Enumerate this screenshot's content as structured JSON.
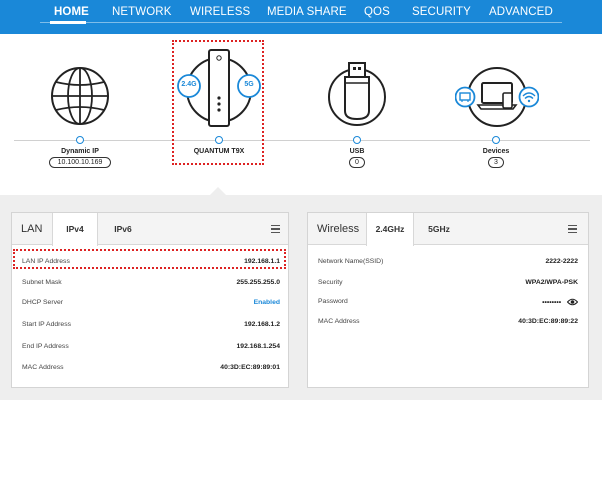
{
  "nav": {
    "items": [
      "HOME",
      "NETWORK",
      "WIRELESS",
      "MEDIA SHARE",
      "QOS",
      "SECURITY",
      "ADVANCED"
    ],
    "active": "HOME"
  },
  "topology": {
    "internet": {
      "label": "Dynamic IP",
      "value": "10.100.10.169",
      "icon": "globe-icon"
    },
    "router": {
      "label": "QUANTUM T9X",
      "band_a": "2.4G",
      "band_b": "5G",
      "icon": "router-icon"
    },
    "usb": {
      "label": "USB",
      "value": "0",
      "icon": "usb-drive-icon"
    },
    "devices": {
      "label": "Devices",
      "value": "3",
      "icon": "devices-icon"
    }
  },
  "lan_panel": {
    "title": "LAN",
    "tabs": [
      "IPv4",
      "IPv6"
    ],
    "active_tab": "IPv4",
    "rows": [
      {
        "key": "LAN IP Address",
        "value": "192.168.1.1"
      },
      {
        "key": "Subnet Mask",
        "value": "255.255.255.0"
      },
      {
        "key": "DHCP Server",
        "value": "Enabled"
      },
      {
        "key": "Start IP Address",
        "value": "192.168.1.2"
      },
      {
        "key": "End IP Address",
        "value": "192.168.1.254"
      },
      {
        "key": "MAC Address",
        "value": "40:3D:EC:89:89:01"
      }
    ]
  },
  "wireless_panel": {
    "title": "Wireless",
    "tabs": [
      "2.4GHz",
      "5GHz"
    ],
    "active_tab": "2.4GHz",
    "rows": [
      {
        "key": "Network Name(SSID)",
        "value": "2222-2222"
      },
      {
        "key": "Security",
        "value": "WPA2/WPA-PSK"
      },
      {
        "key": "Password",
        "value": "••••••••"
      },
      {
        "key": "MAC Address",
        "value": "40:3D:EC:89:89:22"
      }
    ]
  },
  "colors": {
    "brand": "#1a88d8",
    "highlight": "#dd2222",
    "panel_bg": "#eeeeee"
  }
}
